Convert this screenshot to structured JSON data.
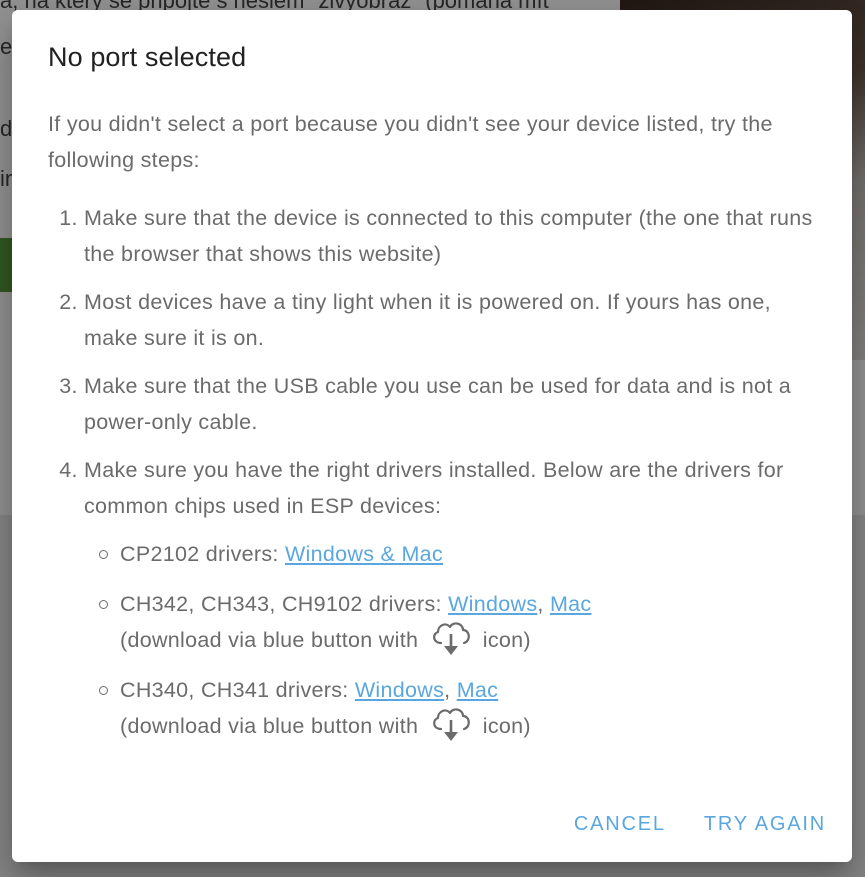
{
  "background": {
    "line1": "a, na který se připojte s heslem \"zivyobraz\" (pomáhá mít",
    "line2": "e",
    "line3": "da",
    "line4": "in"
  },
  "dialog": {
    "title": "No port selected",
    "intro": "If you didn't select a port because you didn't see your device listed, try the following steps:",
    "steps": [
      "Make sure that the device is connected to this computer (the one that runs the browser that shows this website)",
      "Most devices have a tiny light when it is powered on. If yours has one, make sure it is on.",
      "Make sure that the USB cable you use can be used for data and is not a power-only cable.",
      "Make sure you have the right drivers installed. Below are the drivers for common chips used in ESP devices:"
    ],
    "drivers": [
      {
        "label": "CP2102 drivers: ",
        "link1": "Windows & Mac"
      },
      {
        "label": "CH342, CH343, CH9102 drivers: ",
        "link1": "Windows",
        "sep": ", ",
        "link2": "Mac",
        "note_before": "(download via blue button with ",
        "icon": "cloud-download-icon",
        "note_after": " icon)"
      },
      {
        "label": "CH340, CH341 drivers: ",
        "link1": "Windows",
        "sep": ", ",
        "link2": "Mac",
        "note_before": "(download via blue button with ",
        "icon": "cloud-download-icon",
        "note_after": " icon)"
      }
    ],
    "cancel_label": "CANCEL",
    "retry_label": "TRY AGAIN",
    "accent_color": "#5aa7e0"
  }
}
